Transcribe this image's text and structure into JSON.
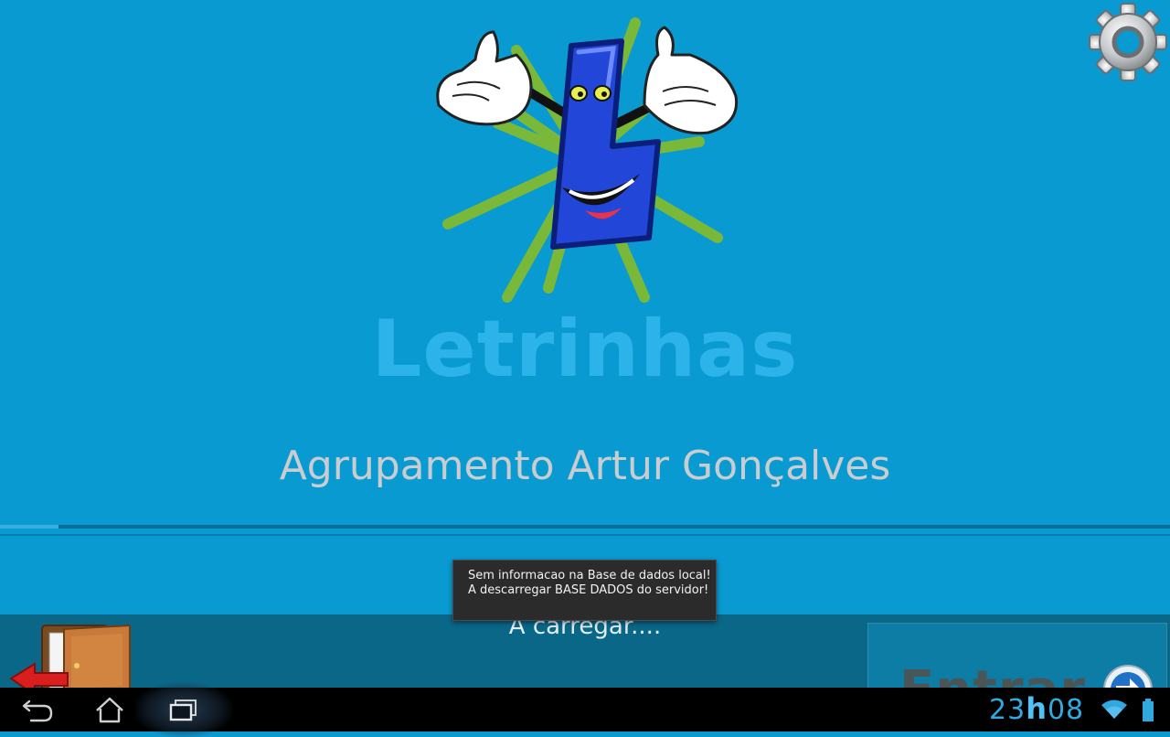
{
  "app": {
    "title": "Letrinhas",
    "subtitle": "Agrupamento Artur Gonçalves",
    "loading_text": "A carregar....",
    "progress": 0.05,
    "enter_label": "Entrar",
    "settings_icon": "gear-icon",
    "exit_icon": "exit-door-icon",
    "mascot_icon": "letrinhas-mascot-logo"
  },
  "toast": {
    "line1": "Sem informacao na Base de dados local!",
    "line2": "A descarregar BASE DADOS do servidor!"
  },
  "status_bar": {
    "hours": "23",
    "separator": "h",
    "minutes": "08",
    "wifi_icon": "wifi-icon",
    "battery_icon": "battery-icon"
  },
  "nav": {
    "back_icon": "back-icon",
    "home_icon": "home-icon",
    "recents_icon": "recent-apps-icon"
  },
  "colors": {
    "background": "#0a9ad2",
    "title": "#2cb4ea",
    "subtitle": "#c9cdd0",
    "footer": "#0a6788",
    "clock": "#2fa9e0"
  }
}
